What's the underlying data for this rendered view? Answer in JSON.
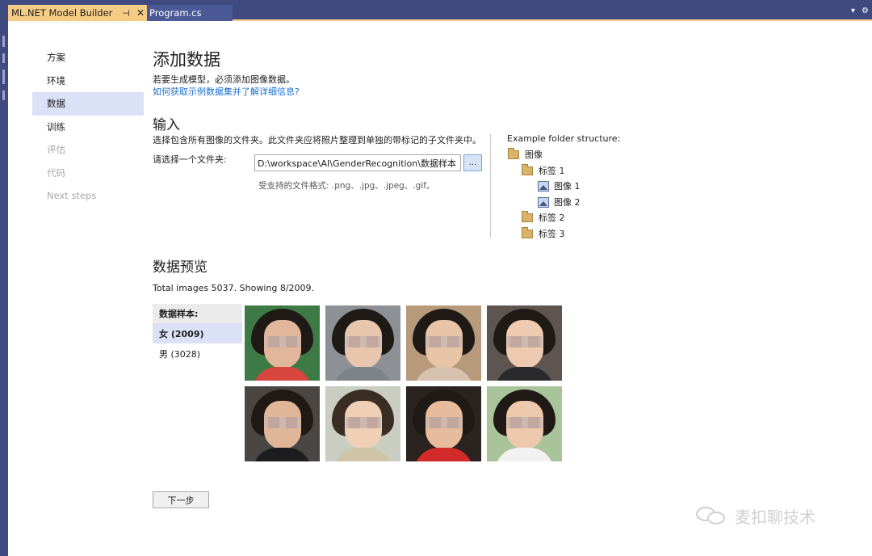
{
  "tabs": {
    "active_label": "ML.NET Model Builder",
    "pin_glyph": "⊣",
    "close_glyph": "✕",
    "inactive_label": "Program.cs",
    "dropdown_glyph": "▾",
    "settings_glyph": "⚙"
  },
  "nav": {
    "items": [
      {
        "label": "方案",
        "state": "normal"
      },
      {
        "label": "环境",
        "state": "normal"
      },
      {
        "label": "数据",
        "state": "selected"
      },
      {
        "label": "训练",
        "state": "normal"
      },
      {
        "label": "评估",
        "state": "disabled"
      },
      {
        "label": "代码",
        "state": "disabled"
      },
      {
        "label": "Next steps",
        "state": "disabled"
      }
    ]
  },
  "main": {
    "title": "添加数据",
    "subtitle": "若要生成模型，必须添加图像数据。",
    "help_link": "如何获取示例数据集并了解详细信息?",
    "input_section": {
      "heading": "输入",
      "description": "选择包含所有图像的文件夹。此文件夹应将照片整理到单独的带标记的子文件夹中。",
      "folder_label": "请选择一个文件夹:",
      "folder_value": "D:\\workspace\\AI\\GenderRecognition\\数据样本",
      "browse_label": "...",
      "formats": "受支持的文件格式: .png、.jpg、.jpeg、.gif。"
    },
    "example": {
      "title": "Example folder structure:",
      "tree": [
        {
          "label": "图像",
          "icon": "folder-icon",
          "level": 0
        },
        {
          "label": "标签 1",
          "icon": "folder-icon",
          "level": 1
        },
        {
          "label": "图像 1",
          "icon": "image-icon",
          "level": 2
        },
        {
          "label": "图像 2",
          "icon": "image-icon",
          "level": 2
        },
        {
          "label": "标签 2",
          "icon": "folder-icon",
          "level": 1
        },
        {
          "label": "标签 3",
          "icon": "folder-icon",
          "level": 1
        }
      ]
    },
    "preview": {
      "heading": "数据预览",
      "total_text": "Total images 5037. Showing 8/2009.",
      "labels_header": "数据样本:",
      "labels": [
        {
          "label": "女 (2009)",
          "selected": true
        },
        {
          "label": "男 (3028)",
          "selected": false
        }
      ],
      "thumbnail_count": 8
    },
    "next_button": "下一步"
  },
  "watermark": {
    "text": "麦扣聊技术"
  },
  "colors": {
    "ide_chrome": "#3f4a80",
    "active_tab": "#f5cc84",
    "selection": "#dbe1f6",
    "link": "#1a6fcf",
    "disabled_text": "#a8a8a8"
  }
}
